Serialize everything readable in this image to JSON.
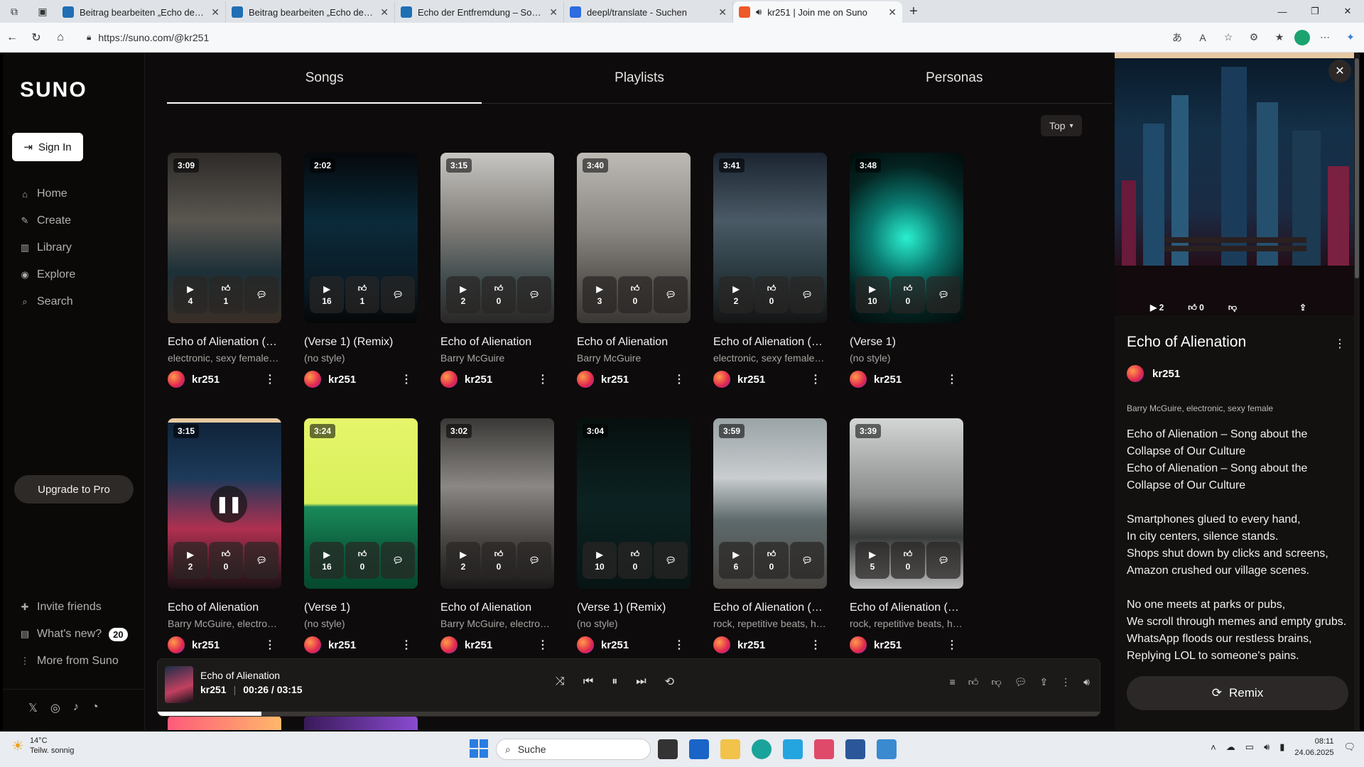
{
  "browser": {
    "tabs": [
      {
        "title": "Beitrag bearbeiten „Echo der Entfr…",
        "fav": "#1f6fb5"
      },
      {
        "title": "Beitrag bearbeiten „Echo der Entfr…",
        "fav": "#1f6fb5"
      },
      {
        "title": "Echo der Entfremdung – Song zur…",
        "fav": "#1f6fb5"
      },
      {
        "title": "deepl/translate - Suchen",
        "fav": "#2c6be0"
      },
      {
        "title": "kr251 | Join me on Suno",
        "fav": "#f05a28"
      }
    ],
    "url": "https://suno.com/@kr251"
  },
  "sidebar": {
    "logo": "SUNO",
    "sign_in": "Sign In",
    "nav": [
      {
        "label": "Home",
        "icon": "home-icon",
        "glyph": "⌂"
      },
      {
        "label": "Create",
        "icon": "create-icon",
        "glyph": "✎"
      },
      {
        "label": "Library",
        "icon": "library-icon",
        "glyph": "▥"
      },
      {
        "label": "Explore",
        "icon": "explore-icon",
        "glyph": "◉"
      },
      {
        "label": "Search",
        "icon": "search-icon",
        "glyph": "⌕"
      }
    ],
    "upgrade": "Upgrade to Pro",
    "bottom": [
      {
        "label": "Invite friends",
        "icon": "gift-icon",
        "glyph": "✚"
      },
      {
        "label": "What's new?",
        "icon": "news-icon",
        "glyph": "▤",
        "badge": "20"
      },
      {
        "label": "More from Suno",
        "icon": "more-icon",
        "glyph": "⋮"
      }
    ]
  },
  "main": {
    "tabs": [
      "Songs",
      "Playlists",
      "Personas"
    ],
    "sort": "Top",
    "songs": [
      {
        "dur": "3:09",
        "plays": "4",
        "likes": "1",
        "title": "Echo of Alienation (R...",
        "sub": "electronic, sexy female, r...",
        "user": "kr251",
        "bg": "linear-gradient(180deg,#2d2a28,#5a5650 40%,#1d3038 70%,#3a2e26)"
      },
      {
        "dur": "2:02",
        "plays": "16",
        "likes": "1",
        "title": "(Verse 1) (Remix)",
        "sub": "(no style)",
        "user": "kr251",
        "bg": "linear-gradient(180deg,#06080c,#0a2a3a 40%,#0a1a24 80%,#050607)"
      },
      {
        "dur": "3:15",
        "plays": "2",
        "likes": "0",
        "title": "Echo of Alienation",
        "sub": "Barry McGuire",
        "user": "kr251",
        "bg": "linear-gradient(180deg,#c8c6c2,#7d7a76 45%,#3e4a4c 75%,#2a2826)"
      },
      {
        "dur": "3:40",
        "plays": "3",
        "likes": "0",
        "title": "Echo of Alienation",
        "sub": "Barry McGuire",
        "user": "kr251",
        "bg": "linear-gradient(180deg,#bdbab5,#8a8782 45%,#5a5753 75%,#3a3734)"
      },
      {
        "dur": "3:41",
        "plays": "2",
        "likes": "0",
        "title": "Echo of Alienation (R...",
        "sub": "electronic, sexy female, r...",
        "user": "kr251",
        "bg": "linear-gradient(180deg,#1a2430,#4a5a66 40%,#2a3a40 70%,#141414)"
      },
      {
        "dur": "3:48",
        "plays": "10",
        "likes": "0",
        "title": "(Verse 1)",
        "sub": "(no style)",
        "user": "kr251",
        "bg": "radial-gradient(circle at 50% 50%,#2af0d0 0,#0a7a70 35%,#042422 70%,#020a0a)"
      },
      {
        "dur": "3:15",
        "plays": "2",
        "likes": "0",
        "title": "Echo of Alienation",
        "sub": "Barry McGuire, electronic...",
        "user": "kr251",
        "bg": "linear-gradient(180deg,#e6c9a3 0,#e6c9a3 6px,#10243a 6px,#1c3a5a 35%,#b03050 65%,#1a1014)",
        "playing": true
      },
      {
        "dur": "3:24",
        "plays": "16",
        "likes": "0",
        "title": "(Verse 1)",
        "sub": "(no style)",
        "user": "kr251",
        "bg": "linear-gradient(180deg,#e6f56a 0,#d8f05a 50%,#1a8a5a 52%,#0a5a3a 80%,#064a2e)"
      },
      {
        "dur": "3:02",
        "plays": "2",
        "likes": "0",
        "title": "Echo of Alienation",
        "sub": "Barry McGuire, electronic...",
        "user": "kr251",
        "bg": "linear-gradient(180deg,#3a3836,#8a8784 40%,#4a4744 70%,#1a1918)"
      },
      {
        "dur": "3:04",
        "plays": "10",
        "likes": "0",
        "title": "(Verse 1) (Remix)",
        "sub": "(no style)",
        "user": "kr251",
        "bg": "linear-gradient(180deg,#06100e,#0c2222 50%,#081414)"
      },
      {
        "dur": "3:59",
        "plays": "6",
        "likes": "0",
        "title": "Echo of Alienation (R...",
        "sub": "rock, repetitive beats, hau...",
        "user": "kr251",
        "bg": "linear-gradient(180deg,#9aa3a6,#c9cdcf 35%,#5e6a6c 60%,#4a4642)"
      },
      {
        "dur": "3:39",
        "plays": "5",
        "likes": "0",
        "title": "Echo of Alienation (R...",
        "sub": "rock, repetitive beats, hau...",
        "user": "kr251",
        "bg": "linear-gradient(180deg,#d4d6d6,#8c8e8e 45%,#3a3c3c 70%,#bfbfbf)"
      }
    ]
  },
  "player": {
    "title": "Echo of Alienation",
    "user": "kr251",
    "time": "00:26 / 03:15",
    "progress": 0.11
  },
  "panel": {
    "plays": "2",
    "likes": "0",
    "title": "Echo of Alienation",
    "user": "kr251",
    "tags": "Barry McGuire, electronic, sexy female",
    "lyrics": "Echo of Alienation – Song about the Collapse of Our Culture\nEcho of Alienation – Song about the Collapse of Our Culture\n\nSmartphones glued to every hand,\nIn city centers, silence stands.\nShops shut down by clicks and screens,\nAmazon crushed our village scenes.\n\nNo one meets at parks or pubs,\nWe scroll through memes and empty grubs.\nWhatsApp floods our restless brains,\nReplying LOL to someone's pains.",
    "remix": "Remix"
  },
  "taskbar": {
    "temp": "14°C",
    "weather": "Teilw. sonnig",
    "search": "Suche",
    "time": "08:11",
    "date": "24.06.2025"
  }
}
